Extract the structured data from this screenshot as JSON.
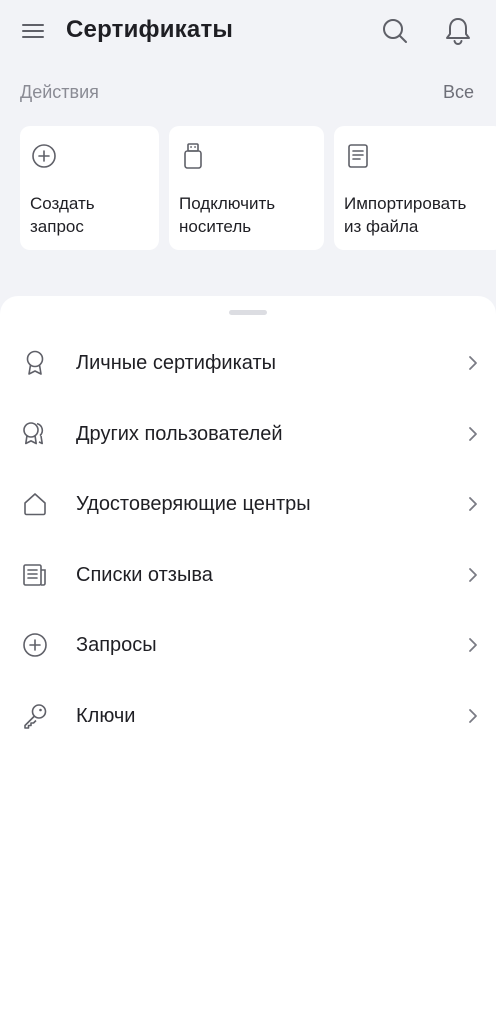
{
  "header": {
    "title": "Сертификаты",
    "icons": [
      "menu-icon",
      "search-icon",
      "bell-icon"
    ]
  },
  "actions": {
    "label": "Действия",
    "all_label": "Все",
    "cards": [
      {
        "label": "Создать\nзапрос",
        "icon": "plus-circle-icon"
      },
      {
        "label": "Подключить\nноситель",
        "icon": "usb-token-icon"
      },
      {
        "label": "Импортировать\nиз файла",
        "icon": "document-icon"
      }
    ]
  },
  "menu": {
    "items": [
      {
        "label": "Личные сертификаты",
        "icon": "award-icon"
      },
      {
        "label": "Других пользователей",
        "icon": "awards-multiple-icon"
      },
      {
        "label": "Удостоверяющие центры",
        "icon": "house-icon"
      },
      {
        "label": "Списки отзыва",
        "icon": "newspaper-icon"
      },
      {
        "label": "Запросы",
        "icon": "plus-circle-icon"
      },
      {
        "label": "Ключи",
        "icon": "key-icon"
      }
    ]
  },
  "colors": {
    "background": "#f2f3f7",
    "surface": "#ffffff",
    "text": "#1f1f24",
    "muted": "#8a8b94",
    "icon": "#5f6068"
  }
}
